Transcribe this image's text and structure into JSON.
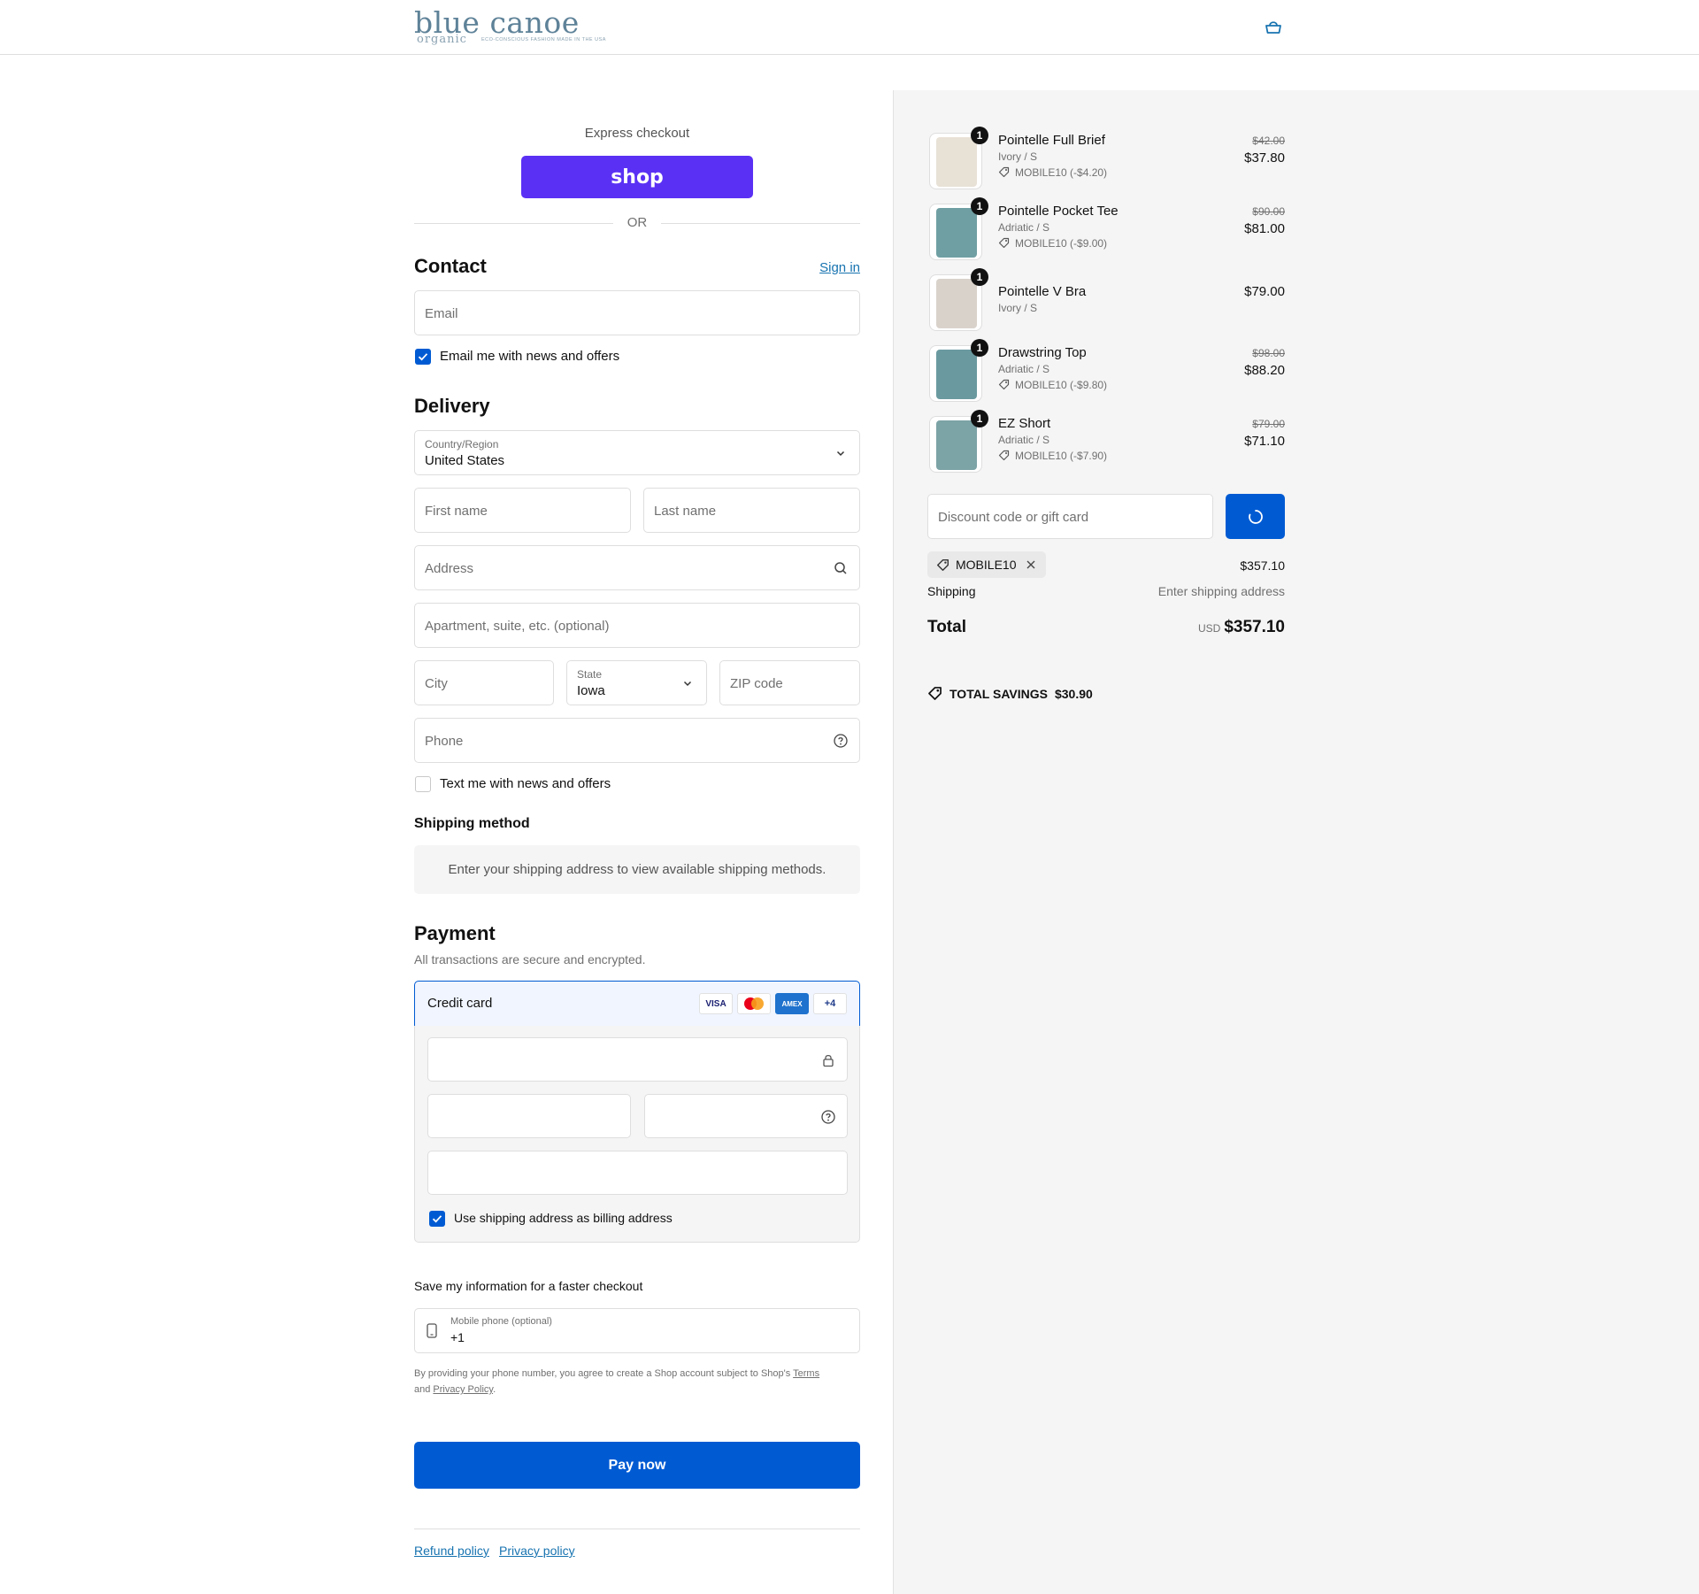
{
  "header": {
    "logo_main": "blue canoe",
    "logo_sub": "organic",
    "logo_tagline": "ECO-CONSCIOUS FASHION MADE IN THE USA"
  },
  "express": {
    "label": "Express checkout",
    "shop_label": "shop",
    "or_label": "OR"
  },
  "contact": {
    "heading": "Contact",
    "sign_in": "Sign in",
    "email_placeholder": "Email",
    "news_label": "Email me with news and offers"
  },
  "delivery": {
    "heading": "Delivery",
    "country_label": "Country/Region",
    "country_value": "United States",
    "first_name": "First name",
    "last_name": "Last name",
    "address": "Address",
    "apartment": "Apartment, suite, etc. (optional)",
    "city": "City",
    "state_label": "State",
    "state_value": "Iowa",
    "zip": "ZIP code",
    "phone": "Phone",
    "text_label": "Text me with news and offers"
  },
  "shipping_method": {
    "heading": "Shipping method",
    "message": "Enter your shipping address to view available shipping methods."
  },
  "payment": {
    "heading": "Payment",
    "subtitle": "All transactions are secure and encrypted.",
    "method": "Credit card",
    "brands": [
      "VISA",
      "MC",
      "AMEX",
      "+4"
    ],
    "billing_label": "Use shipping address as billing address"
  },
  "save_info": {
    "heading": "Save my information for a faster checkout",
    "mobile_label": "Mobile phone (optional)",
    "mobile_value": "+1",
    "legal_prefix": "By providing your phone number, you agree to create a Shop account subject to Shop's",
    "terms": "Terms",
    "and": "and",
    "privacy": "Privacy Policy",
    "period": "."
  },
  "pay_now": "Pay now",
  "footer": {
    "refund": "Refund policy",
    "privacy": "Privacy policy"
  },
  "items": [
    {
      "name": "Pointelle Full Brief",
      "variant": "Ivory / S",
      "discount": "MOBILE10 (-$4.20)",
      "old": "$42.00",
      "price": "$37.80",
      "qty": "1",
      "color": "#e8e1d6"
    },
    {
      "name": "Pointelle Pocket Tee",
      "variant": "Adriatic / S",
      "discount": "MOBILE10 (-$9.00)",
      "old": "$90.00",
      "price": "$81.00",
      "qty": "1",
      "color": "#6f9fa3"
    },
    {
      "name": "Pointelle V Bra",
      "variant": "Ivory / S",
      "discount": "",
      "old": "",
      "price": "$79.00",
      "qty": "1",
      "color": "#d9d2cb"
    },
    {
      "name": "Drawstring Top",
      "variant": "Adriatic / S",
      "discount": "MOBILE10 (-$9.80)",
      "old": "$98.00",
      "price": "$88.20",
      "qty": "1",
      "color": "#6a9aa0"
    },
    {
      "name": "EZ Short",
      "variant": "Adriatic / S",
      "discount": "MOBILE10 (-$7.90)",
      "old": "$79.00",
      "price": "$71.10",
      "qty": "1",
      "color": "#7ca3a6"
    }
  ],
  "summary": {
    "discount_placeholder": "Discount code or gift card",
    "code": "MOBILE10",
    "subtotal": "$357.10",
    "shipping_label": "Shipping",
    "shipping_value": "Enter shipping address",
    "total_label": "Total",
    "currency": "USD",
    "total": "$357.10",
    "savings_label": "TOTAL SAVINGS",
    "savings_value": "$30.90"
  },
  "colors": {
    "primary": "#005bd3",
    "shop_purple": "#5a31f4",
    "sidebar_bg": "#f5f5f5"
  }
}
